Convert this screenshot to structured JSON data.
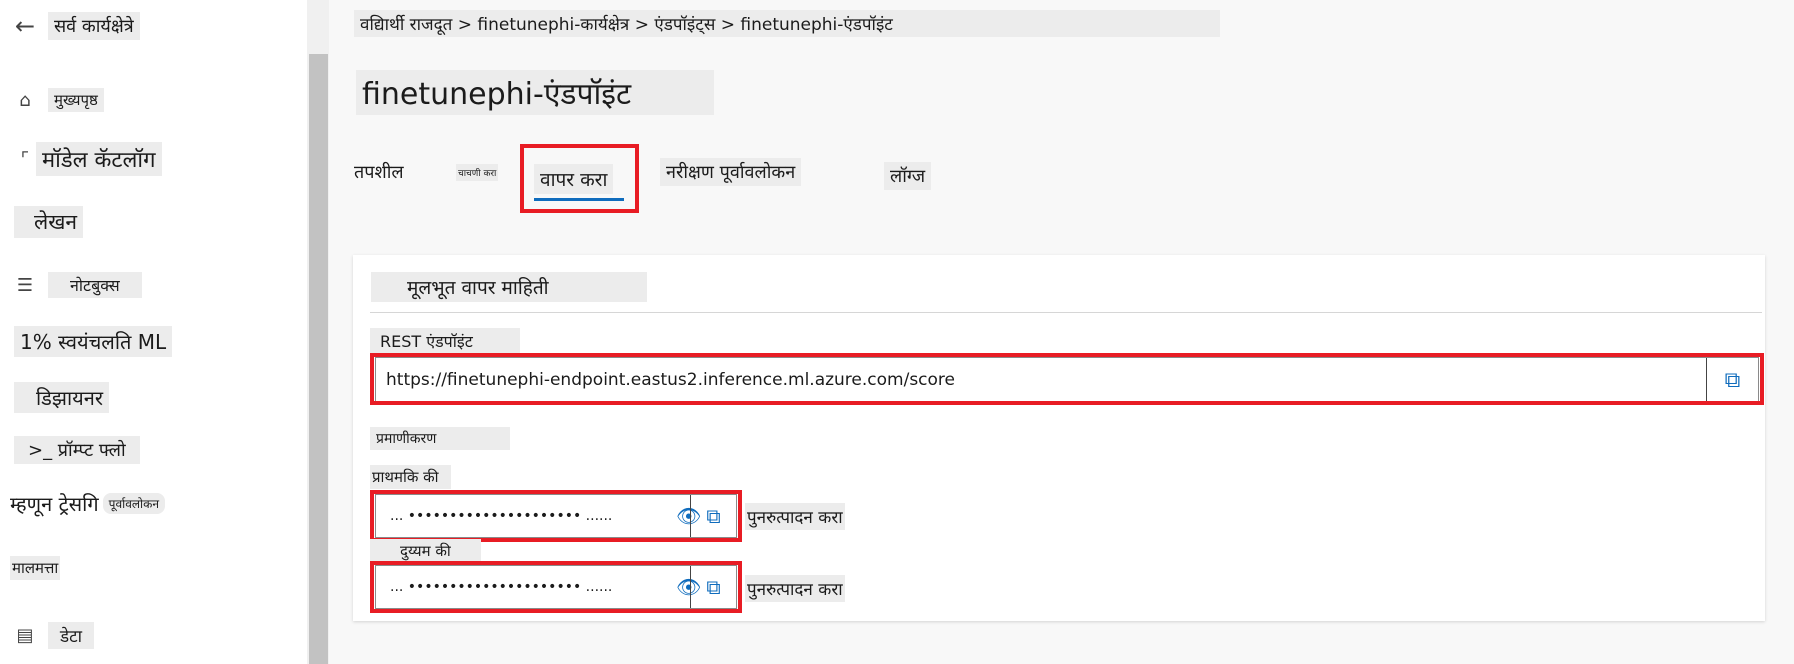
{
  "sidebar": {
    "back_label": "सर्व कार्यक्षेत्रे",
    "items": [
      {
        "label": "मुख्यपृष्ठ",
        "icon": "home-icon"
      },
      {
        "label": "मॉडेल कॅटलॉग",
        "icon": "catalog-icon"
      },
      {
        "label": "लेखन",
        "icon": ""
      },
      {
        "label": "नोटबुक्स",
        "icon": "notebook-icon"
      },
      {
        "label": "1% स्वयंचलति ML",
        "icon": ""
      },
      {
        "label": "डिझायनर",
        "icon": "designer-icon"
      },
      {
        "label": ">_ प्रॉम्प्ट फ्लो",
        "icon": "prompt-flow-icon"
      },
      {
        "label": "म्हणून ट्रेसगि",
        "badge": "पूर्वावलोकन"
      },
      {
        "label": "मालमत्ता"
      },
      {
        "label": "डेटा",
        "icon": "data-icon"
      }
    ]
  },
  "breadcrumb": "वद्यिार्थी राजदूत > finetunephi-कार्यक्षेत्र > एंडपॉइंट्स > finetunephi-एंडपॉइंट",
  "page_title": "finetunephi-एंडपॉइंट",
  "tabs": [
    {
      "label": "तपशील"
    },
    {
      "label": "चाचणी करा"
    },
    {
      "label": "वापर करा",
      "active": true
    },
    {
      "label": "नरीक्षण पूर्वावलोकन"
    },
    {
      "label": "लॉग्ज"
    }
  ],
  "card": {
    "title": "मूलभूत वापर माहिती",
    "rest_label": "REST एंडपॉइंट",
    "rest_url": "https://finetunephi-endpoint.eastus2.inference.ml.azure.com/score",
    "auth_label": "प्रमाणीकरण",
    "primary_label": "प्राथमकि की",
    "primary_value": "... ••••••••••••••••••••• ......",
    "secondary_label": "दुय्यम की",
    "secondary_value": "... ••••••••••••••••••••• ......",
    "regenerate_label": "पुनरुत्पादन करा"
  },
  "colors": {
    "accent": "#0f6cbd",
    "highlight": "#e81c24"
  }
}
